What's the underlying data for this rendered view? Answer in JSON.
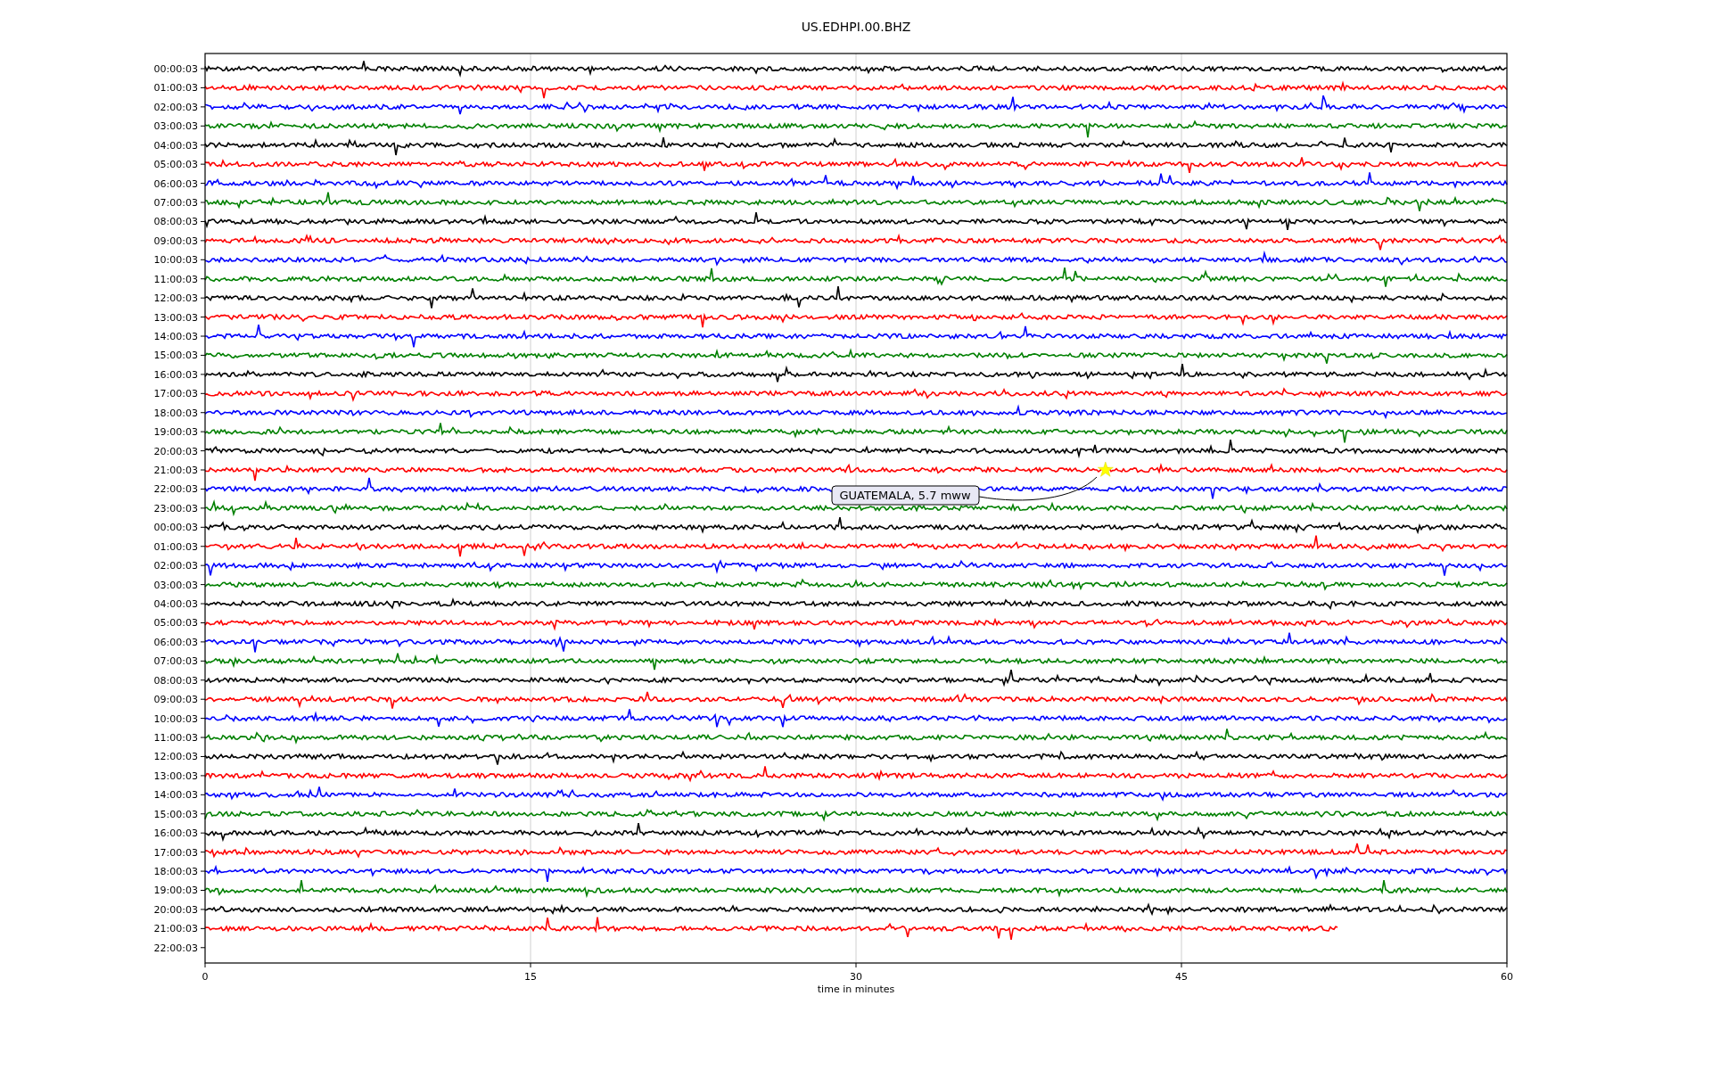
{
  "plot": {
    "title": "US.EDHPI.00.BHZ",
    "xlabel": "time in minutes",
    "xticks": [
      "0",
      "15",
      "30",
      "45",
      "60"
    ],
    "rows": [
      {
        "label": "00:00:03",
        "color": "#000000",
        "kind": "full"
      },
      {
        "label": "01:00:03",
        "color": "#ff0000",
        "kind": "full"
      },
      {
        "label": "02:00:03",
        "color": "#0000ff",
        "kind": "full"
      },
      {
        "label": "03:00:03",
        "color": "#008000",
        "kind": "full"
      },
      {
        "label": "04:00:03",
        "color": "#000000",
        "kind": "full"
      },
      {
        "label": "05:00:03",
        "color": "#ff0000",
        "kind": "full"
      },
      {
        "label": "06:00:03",
        "color": "#0000ff",
        "kind": "full"
      },
      {
        "label": "07:00:03",
        "color": "#008000",
        "kind": "full"
      },
      {
        "label": "08:00:03",
        "color": "#000000",
        "kind": "full"
      },
      {
        "label": "09:00:03",
        "color": "#ff0000",
        "kind": "full"
      },
      {
        "label": "10:00:03",
        "color": "#0000ff",
        "kind": "full"
      },
      {
        "label": "11:00:03",
        "color": "#008000",
        "kind": "full"
      },
      {
        "label": "12:00:03",
        "color": "#000000",
        "kind": "full"
      },
      {
        "label": "13:00:03",
        "color": "#ff0000",
        "kind": "full"
      },
      {
        "label": "14:00:03",
        "color": "#0000ff",
        "kind": "full"
      },
      {
        "label": "15:00:03",
        "color": "#008000",
        "kind": "full"
      },
      {
        "label": "16:00:03",
        "color": "#000000",
        "kind": "full"
      },
      {
        "label": "17:00:03",
        "color": "#ff0000",
        "kind": "full"
      },
      {
        "label": "18:00:03",
        "color": "#0000ff",
        "kind": "full"
      },
      {
        "label": "19:00:03",
        "color": "#008000",
        "kind": "full"
      },
      {
        "label": "20:00:03",
        "color": "#000000",
        "kind": "full"
      },
      {
        "label": "21:00:03",
        "color": "#ff0000",
        "kind": "full"
      },
      {
        "label": "22:00:03",
        "color": "#0000ff",
        "kind": "full"
      },
      {
        "label": "23:00:03",
        "color": "#008000",
        "kind": "full"
      },
      {
        "label": "00:00:03",
        "color": "#000000",
        "kind": "full"
      },
      {
        "label": "01:00:03",
        "color": "#ff0000",
        "kind": "full"
      },
      {
        "label": "02:00:03",
        "color": "#0000ff",
        "kind": "full"
      },
      {
        "label": "03:00:03",
        "color": "#008000",
        "kind": "full"
      },
      {
        "label": "04:00:03",
        "color": "#000000",
        "kind": "full"
      },
      {
        "label": "05:00:03",
        "color": "#ff0000",
        "kind": "full"
      },
      {
        "label": "06:00:03",
        "color": "#0000ff",
        "kind": "full"
      },
      {
        "label": "07:00:03",
        "color": "#008000",
        "kind": "full"
      },
      {
        "label": "08:00:03",
        "color": "#000000",
        "kind": "full"
      },
      {
        "label": "09:00:03",
        "color": "#ff0000",
        "kind": "full"
      },
      {
        "label": "10:00:03",
        "color": "#0000ff",
        "kind": "full"
      },
      {
        "label": "11:00:03",
        "color": "#008000",
        "kind": "full"
      },
      {
        "label": "12:00:03",
        "color": "#000000",
        "kind": "full"
      },
      {
        "label": "13:00:03",
        "color": "#ff0000",
        "kind": "full"
      },
      {
        "label": "14:00:03",
        "color": "#0000ff",
        "kind": "full"
      },
      {
        "label": "15:00:03",
        "color": "#008000",
        "kind": "full"
      },
      {
        "label": "16:00:03",
        "color": "#000000",
        "kind": "full"
      },
      {
        "label": "17:00:03",
        "color": "#ff0000",
        "kind": "full"
      },
      {
        "label": "18:00:03",
        "color": "#0000ff",
        "kind": "full"
      },
      {
        "label": "19:00:03",
        "color": "#008000",
        "kind": "full"
      },
      {
        "label": "20:00:03",
        "color": "#000000",
        "kind": "full"
      },
      {
        "label": "21:00:03",
        "color": "#ff0000",
        "kind": "partial"
      },
      {
        "label": "22:00:03",
        "kind": "empty"
      }
    ],
    "annotation": {
      "text": "GUATEMALA, 5.7 mww"
    }
  }
}
